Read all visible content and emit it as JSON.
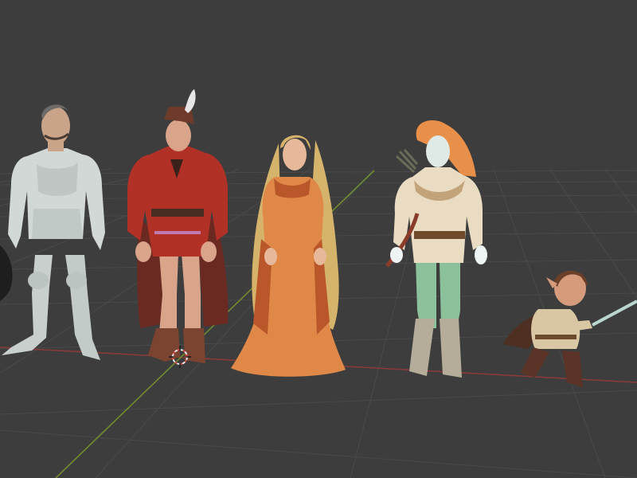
{
  "viewport": {
    "mode": "3d-perspective",
    "grid_visible": true
  },
  "colors": {
    "background": "#3d3d3d",
    "grid_line": "#4b4b4b",
    "x_axis": "#8c3b3b",
    "y_axis": "#6d8a2d",
    "cursor_red": "#d84b4b",
    "cursor_white": "#e8e8e8"
  },
  "scene": {
    "characters": [
      {
        "id": "knight",
        "icon": "armored-knight-figure-icon"
      },
      {
        "id": "archer-man",
        "icon": "red-tunic-man-figure-icon"
      },
      {
        "id": "princess",
        "icon": "long-haired-woman-figure-icon"
      },
      {
        "id": "ranger",
        "icon": "ranger-woman-figure-icon"
      },
      {
        "id": "halfling",
        "icon": "swordsman-halfling-figure-icon"
      }
    ],
    "cursor_icon": "3d-cursor-icon"
  }
}
